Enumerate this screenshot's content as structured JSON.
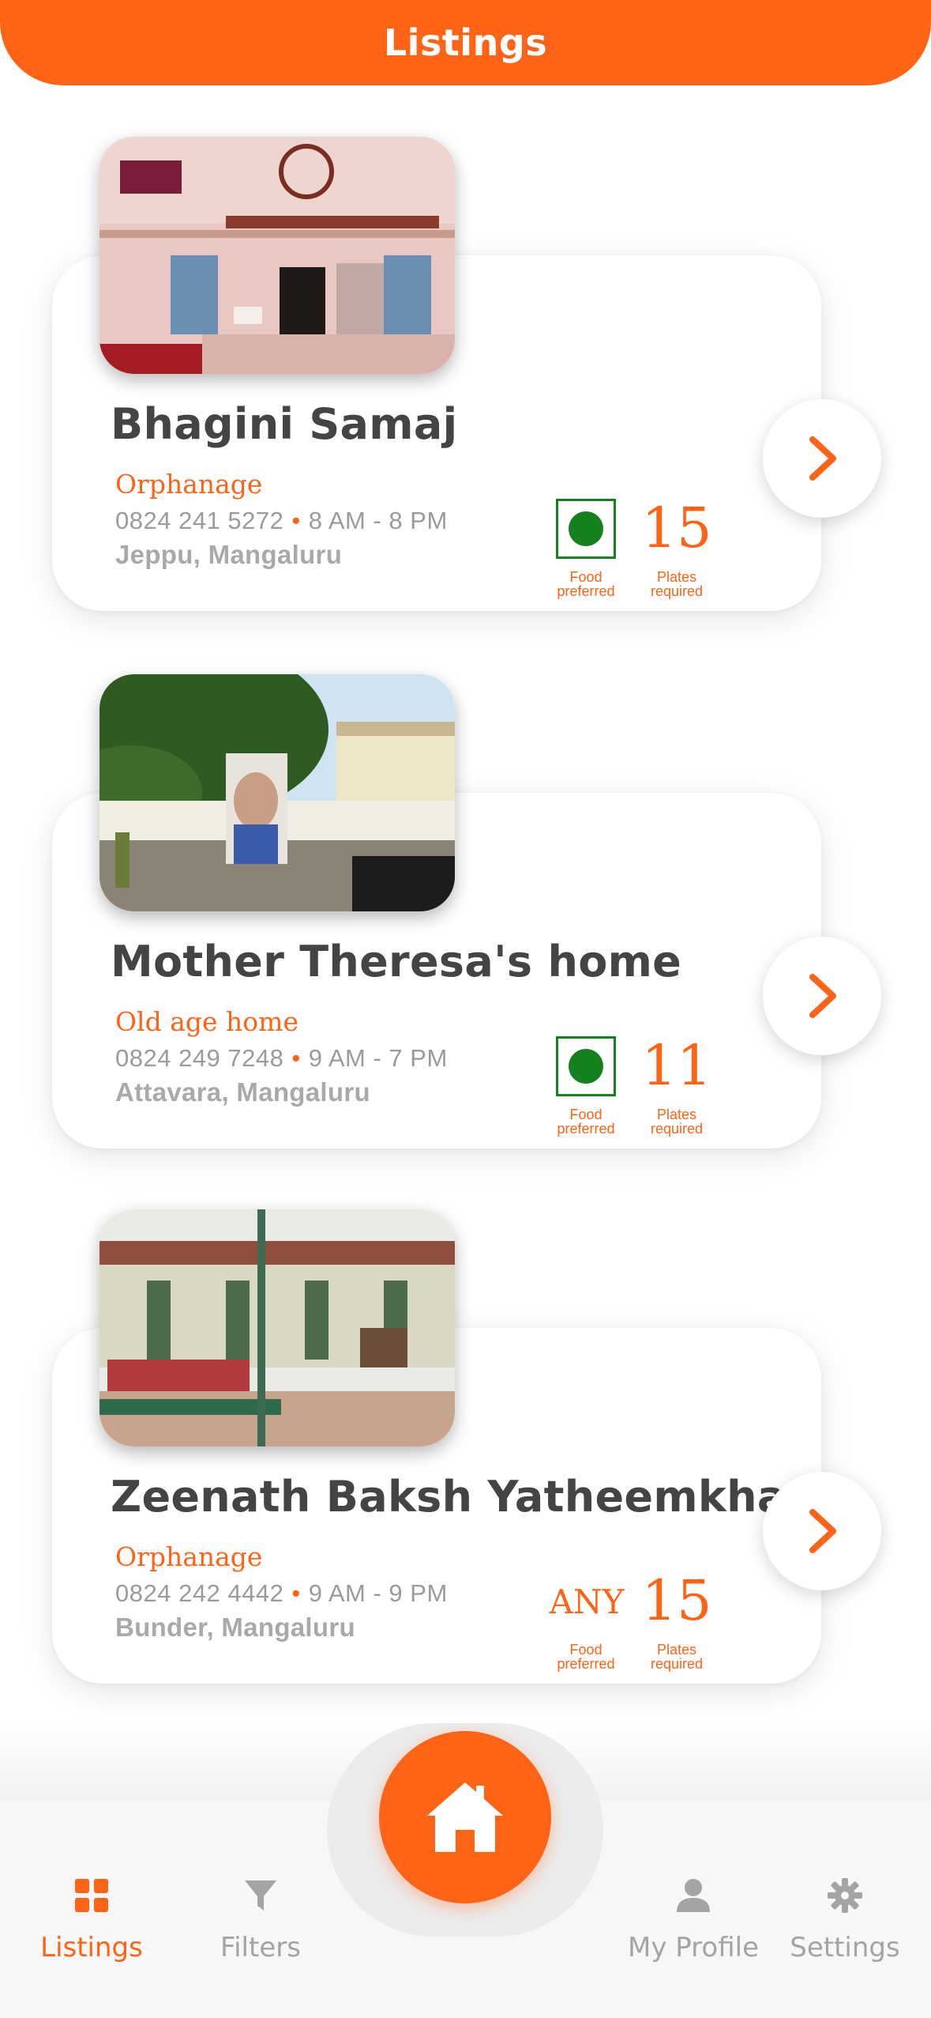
{
  "header": {
    "title": "Listings"
  },
  "listings": [
    {
      "name": "Bhagini Samaj",
      "category": "Orphanage",
      "phone": "0824 241 5272",
      "separator": "•",
      "hours": "8 AM - 8 PM",
      "location": "Jeppu, Mangaluru",
      "food": "veg-icon",
      "food_label": "Food preferred",
      "plates": "15",
      "plates_label": "Plates required"
    },
    {
      "name": "Mother Theresa's home",
      "category": "Old age home",
      "phone": "0824 249 7248",
      "separator": "•",
      "hours": "9 AM - 7 PM",
      "location": "Attavara, Mangaluru",
      "food": "veg-icon",
      "food_label": "Food preferred",
      "plates": "11",
      "plates_label": "Plates required"
    },
    {
      "name": "Zeenath Baksh Yatheemkhana",
      "category": "Orphanage",
      "phone": "0824 242 4442",
      "separator": "•",
      "hours": "9 AM - 9 PM",
      "location": "Bunder, Mangaluru",
      "food": "ANY",
      "food_label": "Food preferred",
      "plates": "15",
      "plates_label": "Plates required"
    }
  ],
  "nav": {
    "tabs": [
      {
        "label": "Listings",
        "icon": "grid-icon",
        "active": true
      },
      {
        "label": "Filters",
        "icon": "filter-icon",
        "active": false
      },
      {
        "label": "My Profile",
        "icon": "person-icon",
        "active": false
      },
      {
        "label": "Settings",
        "icon": "gear-icon",
        "active": false
      }
    ],
    "center_icon": "home-icon"
  },
  "colors": {
    "accent": "#FF6316",
    "veg": "#14811E",
    "text_dark": "#444444",
    "text_muted": "#9b9b9b"
  }
}
